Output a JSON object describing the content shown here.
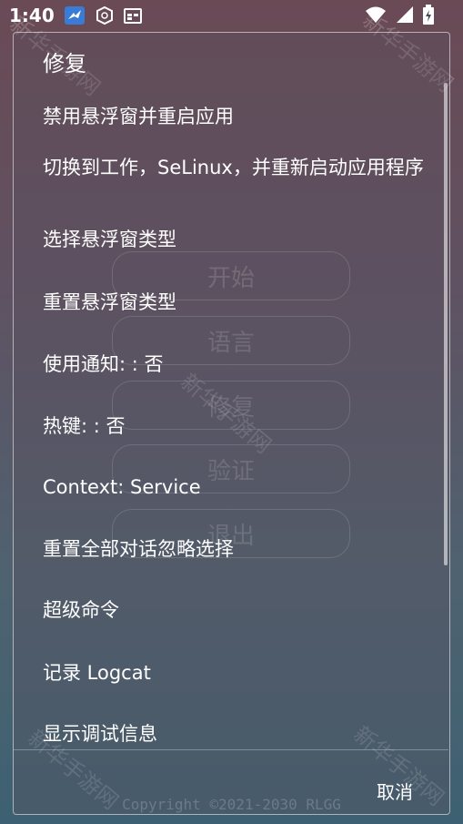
{
  "status_bar": {
    "time": "1:40",
    "left_icons": [
      "bird-app-icon",
      "fingerprint-app-icon",
      "calendar-icon"
    ],
    "right_icons": [
      "wifi-icon",
      "signal-icon",
      "battery-charging-icon"
    ]
  },
  "background_app": {
    "buttons": [
      "开始",
      "语言",
      "修复",
      "验证",
      "退出"
    ],
    "copyright": "Copyright ©2021-2030 RLGG",
    "watermark": "新华手游网"
  },
  "dialog": {
    "title": "修复",
    "items": [
      "禁用悬浮窗并重启应用",
      "切换到工作，SeLinux，并重新启动应用程序",
      "选择悬浮窗类型",
      "重置悬浮窗类型",
      "使用通知: : 否",
      "热键: : 否",
      "Context: Service",
      "重置全部对话忽略选择",
      "超级命令",
      "记录 Logcat",
      "显示调试信息"
    ],
    "cancel_label": "取消"
  },
  "colors": {
    "background_top": "#6a4a55",
    "background_bottom": "#3d6172",
    "text": "#ffffff"
  }
}
